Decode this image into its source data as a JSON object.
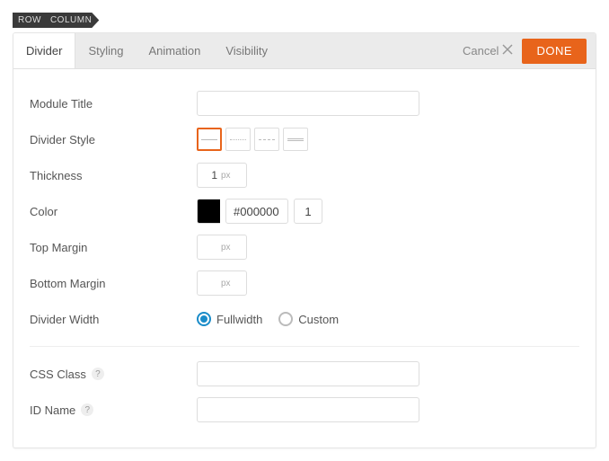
{
  "breadcrumb": {
    "row": "ROW",
    "column": "COLUMN"
  },
  "tabs": {
    "divider": "Divider",
    "styling": "Styling",
    "animation": "Animation",
    "visibility": "Visibility"
  },
  "actions": {
    "cancel": "Cancel",
    "done": "DONE"
  },
  "labels": {
    "module_title": "Module Title",
    "divider_style": "Divider Style",
    "thickness": "Thickness",
    "color": "Color",
    "top_margin": "Top Margin",
    "bottom_margin": "Bottom Margin",
    "divider_width": "Divider Width",
    "css_class": "CSS Class",
    "id_name": "ID Name",
    "px": "px"
  },
  "fields": {
    "module_title": "",
    "thickness": "1",
    "color_hex": "#000000",
    "color_swatch": "#000000",
    "opacity": "1",
    "top_margin": "",
    "bottom_margin": "",
    "css_class": "",
    "id_name": ""
  },
  "divider_width": {
    "fullwidth": "Fullwidth",
    "custom": "Custom"
  }
}
